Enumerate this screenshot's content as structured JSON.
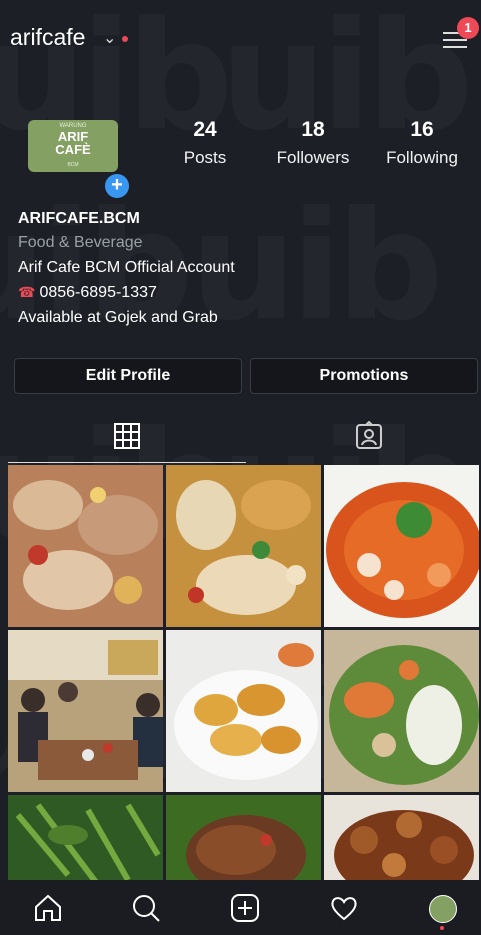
{
  "header": {
    "username": "arifcafe",
    "notification_count": "1",
    "icons": [
      "chevron-down-icon",
      "hamburger-menu-icon"
    ]
  },
  "profile": {
    "avatar": {
      "small_text": "WARUNG",
      "line1": "ARIF",
      "line2": "CAFÈ",
      "sub_text": "BCM"
    },
    "stats": [
      {
        "count": "24",
        "label": "Posts"
      },
      {
        "count": "18",
        "label": "Followers"
      },
      {
        "count": "16",
        "label": "Following"
      }
    ],
    "bio": {
      "name": "ARIFCAFE.BCM",
      "category": "Food & Beverage",
      "line1": "Arif Cafe BCM Official Account",
      "phone": "0856-6895-1337",
      "line3": "Available at Gojek and Grab"
    },
    "buttons": {
      "edit_profile": "Edit Profile",
      "promotions": "Promotions"
    }
  },
  "tabs": [
    {
      "icon": "grid-icon",
      "active": true
    },
    {
      "icon": "tagged-user-icon",
      "active": false
    }
  ],
  "posts": [
    {
      "subject": "fried fish with egg and chili",
      "icon": "food-photo"
    },
    {
      "subject": "squid stir-fry with egg",
      "icon": "food-photo"
    },
    {
      "subject": "tom yum soup",
      "icon": "food-photo"
    },
    {
      "subject": "family dinner at cafe",
      "icon": "people-photo"
    },
    {
      "subject": "fried shrimp",
      "icon": "food-photo"
    },
    {
      "subject": "seafood vegetable stir-fry",
      "icon": "food-photo"
    },
    {
      "subject": "stir-fried kangkung",
      "icon": "food-photo"
    },
    {
      "subject": "fried noodles on banana leaf",
      "icon": "food-photo"
    },
    {
      "subject": "clams in sauce",
      "icon": "food-photo"
    }
  ],
  "watermark": "uib",
  "bottom_nav": [
    "home-icon",
    "search-icon",
    "new-post-icon",
    "activity-heart-icon",
    "profile-avatar-icon"
  ],
  "colors": {
    "background": "#1c1f26",
    "accent_blue": "#3897f0",
    "notification_red": "#ed4956",
    "avatar_green": "#84a063"
  }
}
